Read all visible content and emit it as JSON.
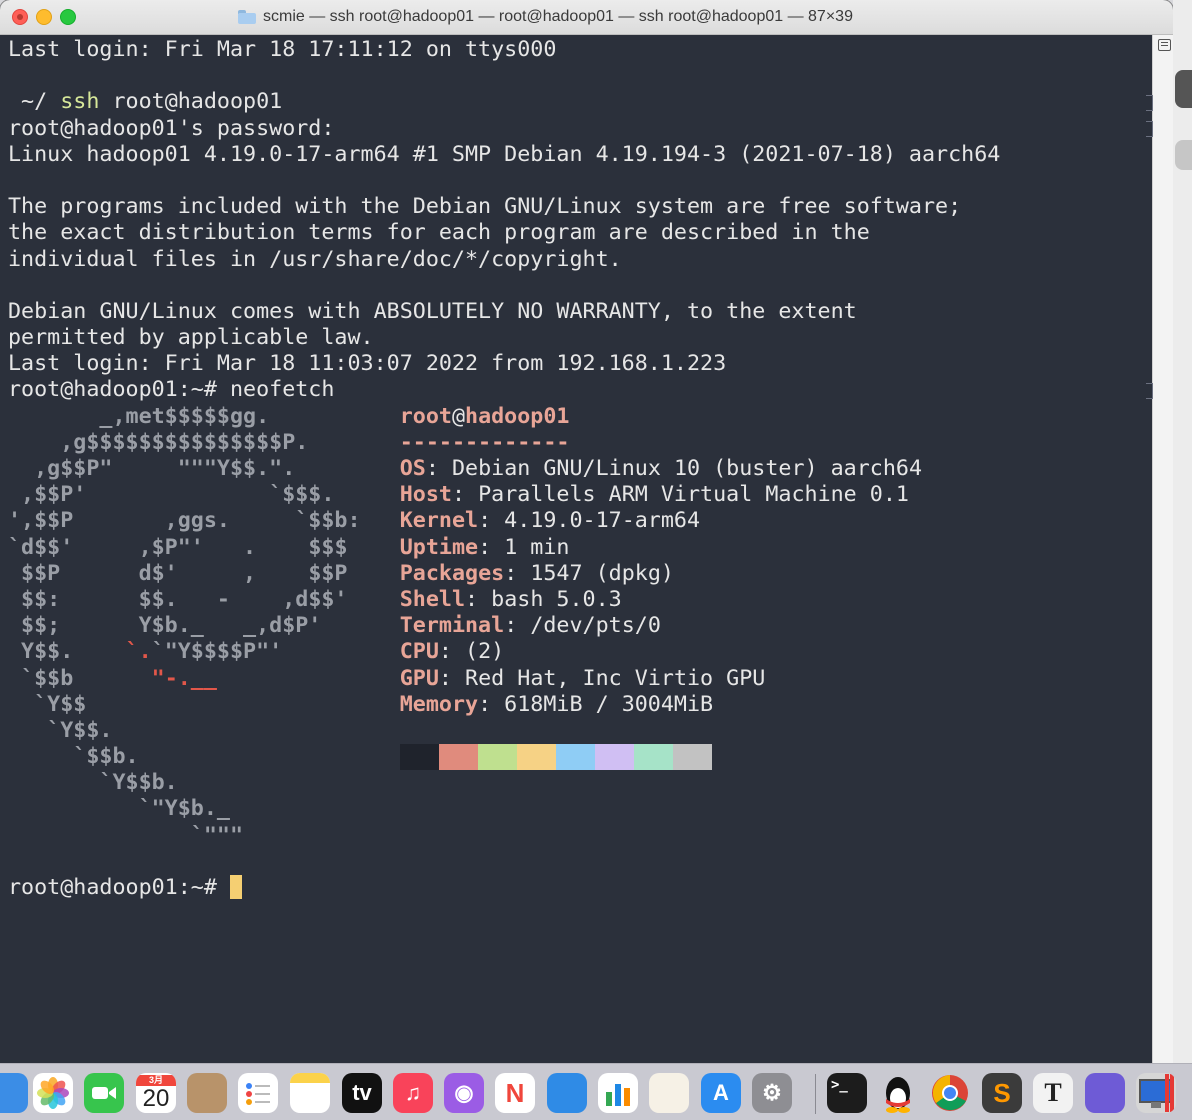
{
  "window": {
    "title": "scmie — ssh root@hadoop01 — root@hadoop01 — ssh root@hadoop01 — 87×39"
  },
  "terminal": {
    "pre_lines": [
      "Last login: Fri Mar 18 17:11:12 on ttys000",
      "",
      "__PROMPT__",
      "root@hadoop01's password:",
      "Linux hadoop01 4.19.0-17-arm64 #1 SMP Debian 4.19.194-3 (2021-07-18) aarch64",
      "",
      "The programs included with the Debian GNU/Linux system are free software;",
      "the exact distribution terms for each program are described in the",
      "individual files in /usr/share/doc/*/copyright.",
      "",
      "Debian GNU/Linux comes with ABSOLUTELY NO WARRANTY, to the extent",
      "permitted by applicable law.",
      "Last login: Fri Mar 18 11:03:07 2022 from 192.168.1.223",
      "root@hadoop01:~# neofetch"
    ],
    "local_prompt": {
      "apple_glyph": "",
      "path": " ~/ ",
      "command": "ssh",
      "args": " root@hadoop01"
    },
    "neofetch": {
      "logo": [
        "       _,met$$$$$gg.",
        "    ,g$$$$$$$$$$$$$$$P.",
        "  ,g$$P\"     \"\"\"Y$$.\".",
        " ,$$P'              `$$$.",
        "',$$P       ,ggs.     `$$b:",
        "`d$$'     ,$P\"'   .    $$$",
        " $$P      d$'     ,    $$P",
        " $$:      $$.   -    ,d$$'",
        " $$;      Y$b._   _,d$P'",
        " Y$$.    `.`\"Y$$$$P\"'",
        " `$$b      \"-.__",
        "  `Y$$",
        "   `Y$$.",
        "     `$$b.",
        "       `Y$$b.",
        "          `\"Y$b._",
        "              `\"\"\""
      ],
      "user": "root",
      "at": "@",
      "host": "hadoop01",
      "separator": "-------------",
      "info": [
        {
          "key": "OS",
          "value": ": Debian GNU/Linux 10 (buster) aarch64"
        },
        {
          "key": "Host",
          "value": ": Parallels ARM Virtual Machine 0.1"
        },
        {
          "key": "Kernel",
          "value": ": 4.19.0-17-arm64"
        },
        {
          "key": "Uptime",
          "value": ": 1 min"
        },
        {
          "key": "Packages",
          "value": ": 1547 (dpkg)"
        },
        {
          "key": "Shell",
          "value": ": bash 5.0.3"
        },
        {
          "key": "Terminal",
          "value": ": /dev/pts/0"
        },
        {
          "key": "CPU",
          "value": ": (2)"
        },
        {
          "key": "GPU",
          "value": ": Red Hat, Inc Virtio GPU"
        },
        {
          "key": "Memory",
          "value": ": 618MiB / 3004MiB"
        }
      ],
      "color_blocks": [
        "#1f232c",
        "#e08b7d",
        "#bfe08f",
        "#f6d285",
        "#8fcdf5",
        "#d0bff3",
        "#a6e3c8",
        "#c2c2c2"
      ]
    },
    "final_prompt": "root@hadoop01:~# "
  },
  "dock": {
    "apps": [
      {
        "name": "finder-partial",
        "label": "",
        "bg": "#3b8de6"
      },
      {
        "name": "photos",
        "label": "",
        "bg": "#ffffff"
      },
      {
        "name": "facetime",
        "label": "",
        "bg": "#37c54d"
      },
      {
        "name": "calendar",
        "label": "20",
        "sub": "3月",
        "bg": "#ffffff"
      },
      {
        "name": "contacts",
        "label": "",
        "bg": "#b8936a"
      },
      {
        "name": "reminders",
        "label": "",
        "bg": "#ffffff"
      },
      {
        "name": "notes",
        "label": "",
        "bg": "#fbe07a"
      },
      {
        "name": "apple-tv",
        "label": "tv",
        "bg": "#111111"
      },
      {
        "name": "music",
        "label": "♫",
        "bg": "#f9435a"
      },
      {
        "name": "podcasts",
        "label": "◉",
        "bg": "#9b5ce5"
      },
      {
        "name": "news",
        "label": "N",
        "bg": "#ffffff"
      },
      {
        "name": "keynote",
        "label": "",
        "bg": "#2f8be6"
      },
      {
        "name": "numbers",
        "label": "",
        "bg": "#ffffff"
      },
      {
        "name": "pages",
        "label": "",
        "bg": "#f6f1e6"
      },
      {
        "name": "app-store",
        "label": "A",
        "bg": "#2b8cf0"
      },
      {
        "name": "system-preferences",
        "label": "⚙",
        "bg": "#8e8e93"
      },
      {
        "name": "terminal",
        "label": ">_",
        "bg": "#1c1c1c"
      },
      {
        "name": "qq",
        "label": "",
        "bg": "transparent"
      },
      {
        "name": "chrome",
        "label": "",
        "bg": "transparent"
      },
      {
        "name": "sublime-text",
        "label": "S",
        "bg": "#3b3b3b"
      },
      {
        "name": "typora",
        "label": "T",
        "bg": "#f2f2f2"
      },
      {
        "name": "cyberduck",
        "label": "",
        "bg": "#6e5bd6"
      },
      {
        "name": "parallels",
        "label": "",
        "bg": "#d6d6d6"
      }
    ]
  }
}
